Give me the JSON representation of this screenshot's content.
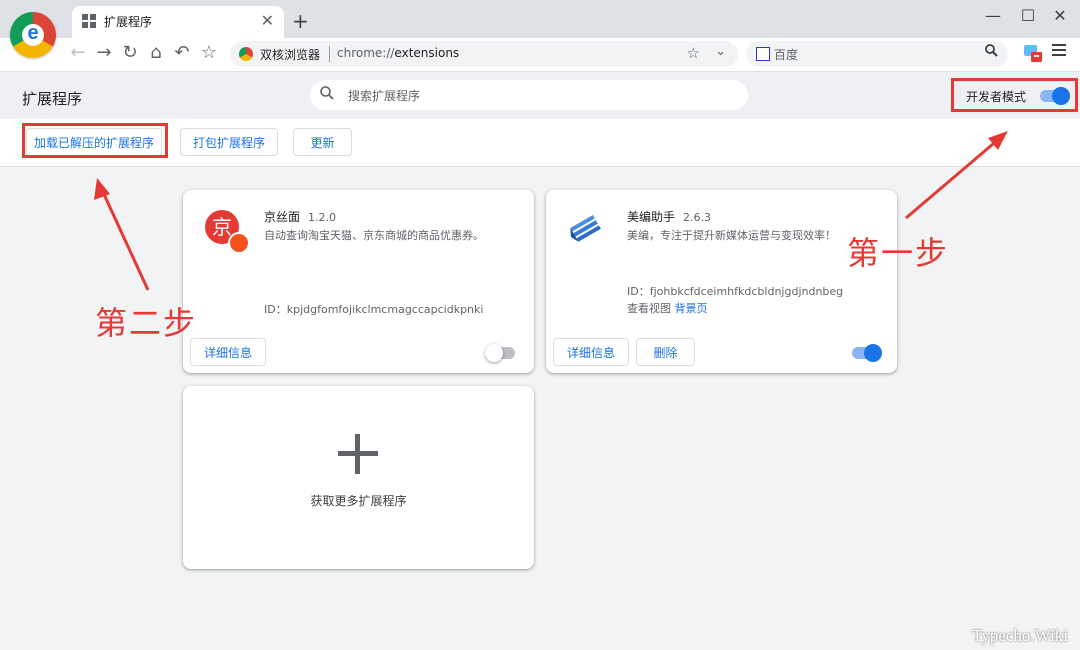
{
  "tab": {
    "title": "扩展程序",
    "close": "✕",
    "new": "+"
  },
  "window": {
    "minimize": "—",
    "maximize": "☐",
    "close": "✕"
  },
  "toolbar": {
    "back": "←",
    "forward": "→",
    "reload": "↻",
    "home": "⌂",
    "undo": "↶",
    "bookmark": "☆",
    "browser_name": "双核浏览器",
    "url_scheme": "chrome://",
    "url_path": "extensions",
    "star": "☆",
    "dropdown": "⌄",
    "search_placeholder": "百度",
    "search_icon": "🔍"
  },
  "page": {
    "title": "扩展程序",
    "search_placeholder": "搜索扩展程序",
    "dev_mode_label": "开发者模式",
    "dev_mode_on": true
  },
  "actions": {
    "load_unpacked": "加载已解压的扩展程序",
    "pack": "打包扩展程序",
    "update": "更新"
  },
  "extensions": [
    {
      "name": "京丝面",
      "version": "1.2.0",
      "description": "自动查询淘宝天猫、京东商城的商品优惠券。",
      "id_line": "ID：kpjdgfomfojikclmcmagccapcidkpnki",
      "details_label": "详细信息",
      "enabled": false,
      "icon_char": "京"
    },
    {
      "name": "美编助手",
      "version": "2.6.3",
      "description": "美编，专注于提升新媒体运营与变现效率！",
      "id_line": "ID：fjohbkcfdceimhfkdcbldnjgdjndnbeg",
      "views_label": "查看视图",
      "views_link": "背景页",
      "details_label": "详细信息",
      "remove_label": "删除",
      "enabled": true
    }
  ],
  "get_more": "获取更多扩展程序",
  "annotations": {
    "step1": "第一步",
    "step2": "第二步"
  },
  "watermark": "Typecho.Wiki",
  "colors": {
    "accent": "#1a73e8",
    "annotation": "#e53935"
  }
}
